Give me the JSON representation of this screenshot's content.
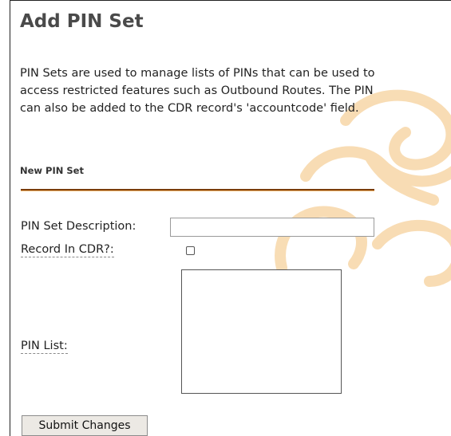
{
  "page": {
    "title": "Add PIN Set",
    "intro_lines": [
      "PIN Sets are used to manage lists of PINs that can be used to",
      "access restricted features such as Outbound Routes. The PIN",
      "can also be added to the CDR record's 'accountcode' field."
    ]
  },
  "form": {
    "section_heading": "New PIN Set",
    "description_label": "PIN Set Description:",
    "description_value": "",
    "record_cdr_label": "Record In CDR?:",
    "record_cdr_checked": false,
    "pin_list_label": "PIN List:",
    "pin_list_value": "",
    "submit_label": "Submit Changes"
  },
  "colors": {
    "section_rule": "#7a3d0a",
    "watermark": "#f7c98a"
  },
  "icons": {
    "watermark": "freepbx-watermark-icon"
  }
}
